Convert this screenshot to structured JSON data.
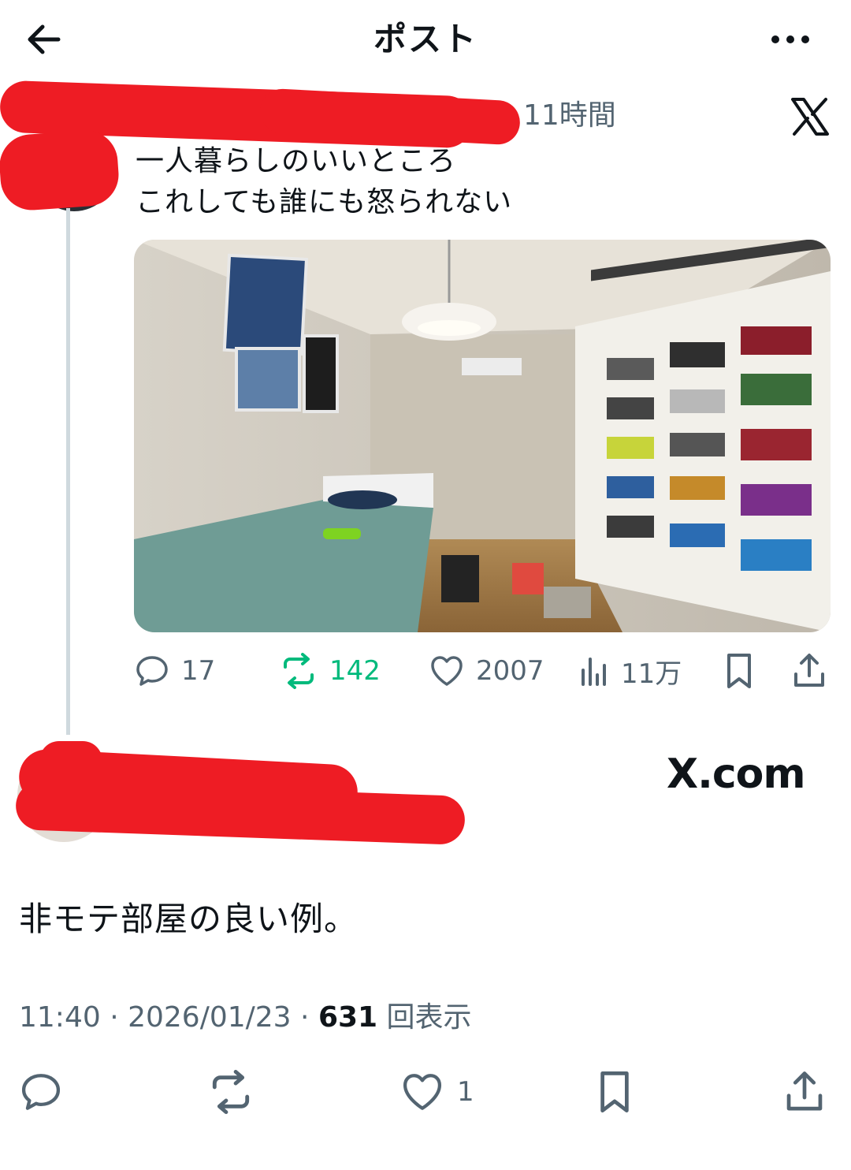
{
  "header": {
    "title": "ポスト"
  },
  "quoted_post": {
    "time": "11時間",
    "text_line1": "一人暮らしのいいところ",
    "text_line2": "これしても誰にも怒られない",
    "stats": {
      "replies": "17",
      "reposts": "142",
      "likes": "2007",
      "views": "11万"
    },
    "colors": {
      "repost": "#00ba7c",
      "muted": "#536471"
    }
  },
  "main_post": {
    "source": "X.com",
    "text": "非モテ部屋の良い例。",
    "time": "11:40",
    "date": "2026/01/23",
    "views_count": "631",
    "views_label": "回表示",
    "likes": "1"
  },
  "icons": {
    "header": [
      "back-arrow-icon",
      "more-icon"
    ],
    "actions": [
      "reply-icon",
      "repost-icon",
      "like-icon",
      "views-icon",
      "bookmark-icon",
      "share-icon"
    ],
    "brand": "x-logo-icon"
  },
  "redaction_color": "#ee1c24"
}
